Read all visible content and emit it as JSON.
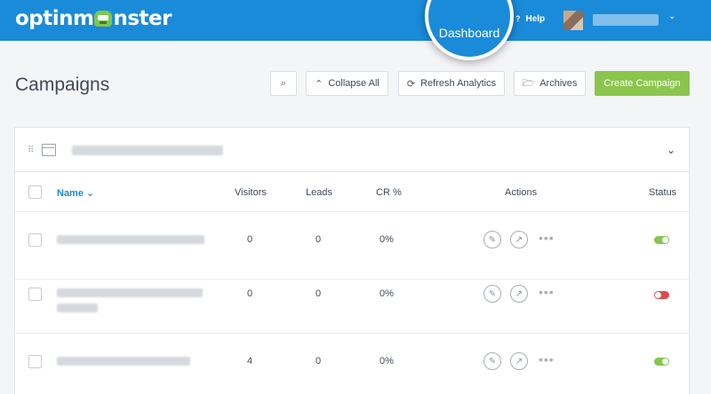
{
  "app": {
    "logo_left": "optinm",
    "logo_right": "nster"
  },
  "topnav": {
    "dashboard": "Dashboard",
    "help_icon": "?",
    "help": "Help",
    "user_chevron": "⌄"
  },
  "page": {
    "title": "Campaigns"
  },
  "toolbar": {
    "search_icon": "⌕",
    "collapse_icon": "⌃",
    "collapse": "Collapse All",
    "refresh_icon": "⟳",
    "refresh": "Refresh Analytics",
    "archives_icon": "🗁",
    "archives": "Archives",
    "create": "Create Campaign"
  },
  "table": {
    "group_chevron": "⌄",
    "drag_icon": "⠿",
    "columns": {
      "name": "Name",
      "name_sort": "⌄",
      "visitors": "Visitors",
      "leads": "Leads",
      "cr": "CR %",
      "actions": "Actions",
      "status": "Status"
    },
    "rows": [
      {
        "visitors": "0",
        "leads": "0",
        "cr": "0%",
        "status": "on"
      },
      {
        "visitors": "0",
        "leads": "0",
        "cr": "0%",
        "status": "off"
      },
      {
        "visitors": "4",
        "leads": "0",
        "cr": "0%",
        "status": "on"
      }
    ],
    "action_icons": {
      "edit": "✎",
      "analytics": "↗",
      "more": "•••"
    }
  },
  "colors": {
    "header": "#1a8bd9",
    "create": "#8cc54e",
    "toggle_on": "#7fc84a",
    "toggle_off": "#e04b4b"
  }
}
